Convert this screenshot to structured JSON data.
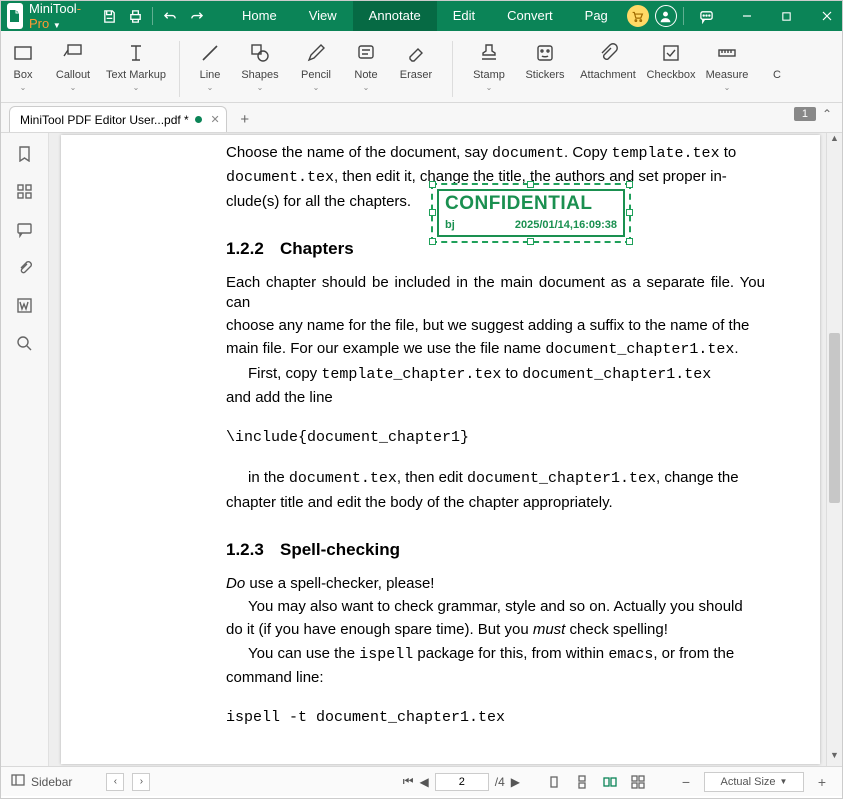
{
  "app": {
    "name": "MiniTool",
    "suffix": "Pro"
  },
  "menu": {
    "home": "Home",
    "view": "View",
    "annotate": "Annotate",
    "edit": "Edit",
    "convert": "Convert",
    "page": "Pag"
  },
  "ribbon": {
    "box": "Box",
    "callout": "Callout",
    "textmarkup": "Text Markup",
    "line": "Line",
    "shapes": "Shapes",
    "pencil": "Pencil",
    "note": "Note",
    "eraser": "Eraser",
    "stamp": "Stamp",
    "stickers": "Stickers",
    "attachment": "Attachment",
    "checkbox": "Checkbox",
    "measure": "Measure",
    "c": "C"
  },
  "tab": {
    "name": "MiniTool PDF Editor User...pdf *"
  },
  "tabright": {
    "badge": "1"
  },
  "side": {},
  "doc": {
    "p1a": "Choose the name of the document, say ",
    "p1b": "document",
    "p1c": ". Copy ",
    "p1d": "template.tex",
    "p1e": " to ",
    "p2a": "document.tex",
    "p2b": ", then edit it, change the title, the authors and set proper in-",
    "p2c": "clude(s) for all the chapters.",
    "h1n": "1.2.2",
    "h1t": "Chapters",
    "p3a": "Each chapter should be included in the main document as a separate file. You can",
    "p3b": "choose any name for the file, but we suggest adding a suffix to the name of the",
    "p3c1": "main file. For our example we use the file name ",
    "p3c2": "document_chapter1.tex",
    "p3c3": ".",
    "p4a": "First, copy ",
    "p4b": "template_chapter.tex",
    "p4c": " to ",
    "p4d": "document_chapter1.tex",
    "p4e": "and add the line",
    "code1": "\\include{document_chapter1}",
    "p5a": "in the ",
    "p5b": "document.tex",
    "p5c": ", then edit ",
    "p5d": "document_chapter1.tex",
    "p5e": ", change the",
    "p5f": "chapter title and edit the body of the chapter appropriately.",
    "h2n": "1.2.3",
    "h2t": "Spell-checking",
    "p6a": "Do",
    "p6b": " use a spell-checker, please!",
    "p7a": "You may also want to check grammar, style and so on.  Actually you should",
    "p7b1": "do it (if you have enough spare time). But you ",
    "p7bm": "must",
    "p7b2": " check spelling!",
    "p8a": "You can use the ",
    "p8b": "ispell",
    "p8c": " package for this, from within ",
    "p8d": "emacs",
    "p8e": ", or from the",
    "p8f": "command line:",
    "code2": "ispell -t document_chapter1.tex"
  },
  "stamp": {
    "title": "CONFIDENTIAL",
    "user": "bj",
    "date": "2025/01/14,16:09:38"
  },
  "status": {
    "sidebar": "Sidebar",
    "page": "2",
    "total": "/4",
    "zoom": "Actual Size"
  }
}
